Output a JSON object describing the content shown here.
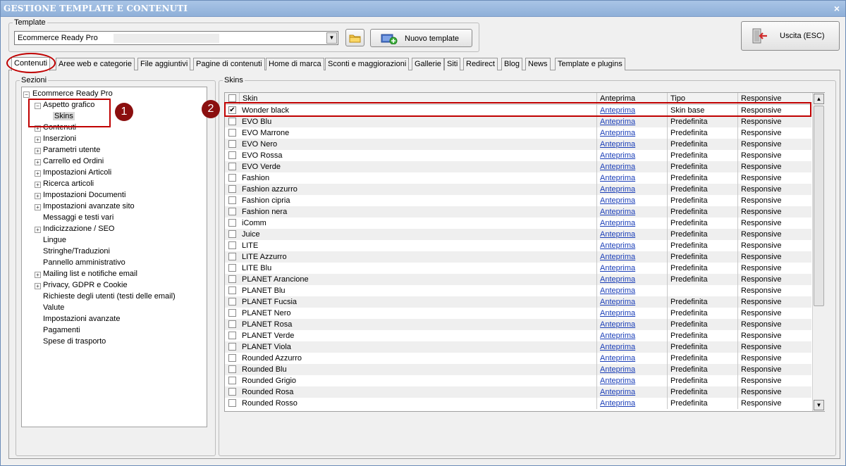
{
  "window": {
    "title": "GESTIONE TEMPLATE E CONTENUTI",
    "close_glyph": "×"
  },
  "template": {
    "group_label": "Template",
    "selected": "Ecommerce Ready Pro",
    "new_button": "Nuovo template"
  },
  "exit_button": "Uscita (ESC)",
  "tabs": [
    "Contenuti",
    "Aree web e categorie",
    "File aggiuntivi",
    "Pagine di contenuti",
    "Home di marca",
    "Sconti e maggiorazioni",
    "Gallerie",
    "Siti",
    "Redirect",
    "Blog",
    "News",
    "Template e plugins"
  ],
  "active_tab": "Contenuti",
  "sections": {
    "group_label": "Sezioni",
    "root": "Ecommerce Ready Pro",
    "items": [
      {
        "label": "Aspetto grafico",
        "expander": "minus",
        "children": [
          "Skins"
        ]
      },
      {
        "label": "Contenuti",
        "expander": "plus"
      },
      {
        "label": "Inserzioni",
        "expander": "plus"
      },
      {
        "label": "Parametri utente",
        "expander": "plus"
      },
      {
        "label": "Carrello ed Ordini",
        "expander": "plus"
      },
      {
        "label": "Impostazioni Articoli",
        "expander": "plus"
      },
      {
        "label": "Ricerca articoli",
        "expander": "plus"
      },
      {
        "label": "Impostazioni Documenti",
        "expander": "plus"
      },
      {
        "label": "Impostazioni avanzate sito",
        "expander": "plus"
      },
      {
        "label": "Messaggi e testi vari",
        "expander": "none"
      },
      {
        "label": "Indicizzazione / SEO",
        "expander": "plus"
      },
      {
        "label": "Lingue",
        "expander": "none"
      },
      {
        "label": "Stringhe/Traduzioni",
        "expander": "none"
      },
      {
        "label": "Pannello amministrativo",
        "expander": "none"
      },
      {
        "label": "Mailing list e notifiche email",
        "expander": "plus"
      },
      {
        "label": "Privacy, GDPR e Cookie",
        "expander": "plus"
      },
      {
        "label": "Richieste degli utenti (testi delle email)",
        "expander": "none"
      },
      {
        "label": "Valute",
        "expander": "none"
      },
      {
        "label": "Impostazioni avanzate",
        "expander": "none"
      },
      {
        "label": "Pagamenti",
        "expander": "none"
      },
      {
        "label": "Spese di trasporto",
        "expander": "none"
      }
    ]
  },
  "skins": {
    "group_label": "Skins",
    "columns": [
      "Skin",
      "Anteprima",
      "Tipo",
      "Responsive"
    ],
    "rows": [
      {
        "skin": "Wonder black",
        "anteprima": "Anteprima",
        "tipo": "Skin base",
        "responsive": "Responsive",
        "checked": true
      },
      {
        "skin": "EVO Blu",
        "anteprima": "Anteprima",
        "tipo": "Predefinita",
        "responsive": "Responsive",
        "checked": false
      },
      {
        "skin": "EVO Marrone",
        "anteprima": "Anteprima",
        "tipo": "Predefinita",
        "responsive": "Responsive",
        "checked": false
      },
      {
        "skin": "EVO Nero",
        "anteprima": "Anteprima",
        "tipo": "Predefinita",
        "responsive": "Responsive",
        "checked": false
      },
      {
        "skin": "EVO Rossa",
        "anteprima": "Anteprima",
        "tipo": "Predefinita",
        "responsive": "Responsive",
        "checked": false
      },
      {
        "skin": "EVO Verde",
        "anteprima": "Anteprima",
        "tipo": "Predefinita",
        "responsive": "Responsive",
        "checked": false
      },
      {
        "skin": "Fashion",
        "anteprima": "Anteprima",
        "tipo": "Predefinita",
        "responsive": "Responsive",
        "checked": false
      },
      {
        "skin": "Fashion azzurro",
        "anteprima": "Anteprima",
        "tipo": "Predefinita",
        "responsive": "Responsive",
        "checked": false
      },
      {
        "skin": "Fashion cipria",
        "anteprima": "Anteprima",
        "tipo": "Predefinita",
        "responsive": "Responsive",
        "checked": false
      },
      {
        "skin": "Fashion nera",
        "anteprima": "Anteprima",
        "tipo": "Predefinita",
        "responsive": "Responsive",
        "checked": false
      },
      {
        "skin": "iComm",
        "anteprima": "Anteprima",
        "tipo": "Predefinita",
        "responsive": "Responsive",
        "checked": false
      },
      {
        "skin": "Juice",
        "anteprima": "Anteprima",
        "tipo": "Predefinita",
        "responsive": "Responsive",
        "checked": false
      },
      {
        "skin": "LITE",
        "anteprima": "Anteprima",
        "tipo": "Predefinita",
        "responsive": "Responsive",
        "checked": false
      },
      {
        "skin": "LITE Azzurro",
        "anteprima": "Anteprima",
        "tipo": "Predefinita",
        "responsive": "Responsive",
        "checked": false
      },
      {
        "skin": "LITE Blu",
        "anteprima": "Anteprima",
        "tipo": "Predefinita",
        "responsive": "Responsive",
        "checked": false
      },
      {
        "skin": "PLANET Arancione",
        "anteprima": "Anteprima",
        "tipo": "Predefinita",
        "responsive": "Responsive",
        "checked": false
      },
      {
        "skin": "PLANET Blu",
        "anteprima": "Anteprima",
        "tipo": "",
        "responsive": "Responsive",
        "checked": false
      },
      {
        "skin": "PLANET Fucsia",
        "anteprima": "Anteprima",
        "tipo": "Predefinita",
        "responsive": "Responsive",
        "checked": false
      },
      {
        "skin": "PLANET Nero",
        "anteprima": "Anteprima",
        "tipo": "Predefinita",
        "responsive": "Responsive",
        "checked": false
      },
      {
        "skin": "PLANET Rosa",
        "anteprima": "Anteprima",
        "tipo": "Predefinita",
        "responsive": "Responsive",
        "checked": false
      },
      {
        "skin": "PLANET Verde",
        "anteprima": "Anteprima",
        "tipo": "Predefinita",
        "responsive": "Responsive",
        "checked": false
      },
      {
        "skin": "PLANET Viola",
        "anteprima": "Anteprima",
        "tipo": "Predefinita",
        "responsive": "Responsive",
        "checked": false
      },
      {
        "skin": "Rounded Azzurro",
        "anteprima": "Anteprima",
        "tipo": "Predefinita",
        "responsive": "Responsive",
        "checked": false
      },
      {
        "skin": "Rounded Blu",
        "anteprima": "Anteprima",
        "tipo": "Predefinita",
        "responsive": "Responsive",
        "checked": false
      },
      {
        "skin": "Rounded Grigio",
        "anteprima": "Anteprima",
        "tipo": "Predefinita",
        "responsive": "Responsive",
        "checked": false
      },
      {
        "skin": "Rounded Rosa",
        "anteprima": "Anteprima",
        "tipo": "Predefinita",
        "responsive": "Responsive",
        "checked": false
      },
      {
        "skin": "Rounded Rosso",
        "anteprima": "Anteprima",
        "tipo": "Predefinita",
        "responsive": "Responsive",
        "checked": false
      }
    ]
  },
  "annotations": {
    "badge1": "1",
    "badge2": "2"
  },
  "colors": {
    "annotation": "#c00000",
    "badge": "#8b0f0f",
    "link": "#1a3eb8",
    "titlebar": "#94b4dc"
  },
  "icons": {
    "folder_button": "folder-icon",
    "new_template": "add-template-icon",
    "exit": "exit-door-icon"
  }
}
